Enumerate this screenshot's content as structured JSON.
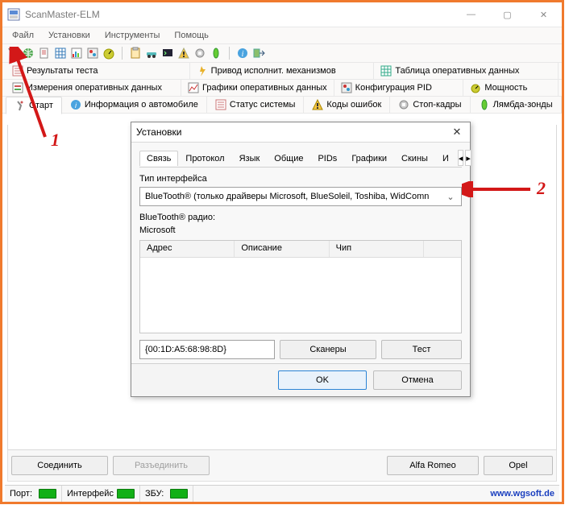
{
  "window": {
    "title": "ScanMaster-ELM",
    "controls": {
      "min": "—",
      "max": "▢",
      "close": "✕"
    }
  },
  "menu": {
    "file": "Файл",
    "settings": "Установки",
    "tools": "Инструменты",
    "help": "Помощь"
  },
  "ribbon_row1": {
    "results": "Результаты теста",
    "actuators": "Привод исполнит. механизмов",
    "runtime": "Таблица оперативных данных"
  },
  "ribbon_row2": {
    "measurements": "Измерения оперативных данных",
    "graphs": "Графики оперативных данных",
    "pidconf": "Конфигурация PID",
    "power": "Мощность"
  },
  "ribbon_row3": {
    "start": "Старт",
    "vehicle": "Информация о автомобиле",
    "status": "Статус системы",
    "codes": "Коды ошибок",
    "freeze": "Стоп-кадры",
    "lambda": "Лямбда-зонды"
  },
  "dialog": {
    "title": "Установки",
    "tabs": {
      "conn": "Связь",
      "proto": "Протокол",
      "lang": "Язык",
      "general": "Общие",
      "pids": "PIDs",
      "charts": "Графики",
      "skins": "Скины",
      "more": "И"
    },
    "iface_label": "Тип интерфейса",
    "iface_value": "BlueTooth® (только драйверы Microsoft, BlueSoleil, Toshiba, WidComn",
    "radio_label": "BlueTooth® радио:",
    "radio_value": "Microsoft",
    "grid": {
      "addr": "Адрес",
      "desc": "Описание",
      "chip": "Чип"
    },
    "mac": "{00:1D:A5:68:98:8D}",
    "btn_scanners": "Сканеры",
    "btn_test": "Тест",
    "btn_ok": "OK",
    "btn_cancel": "Отмена"
  },
  "bottom": {
    "connect": "Соединить",
    "disconnect": "Разъединить",
    "make1": "Alfa Romeo",
    "make2": "Opel"
  },
  "status": {
    "port": "Порт:",
    "iface": "Интерфейс",
    "ecu": "ЗБУ:",
    "url": "www.wgsoft.de"
  },
  "annot": {
    "one": "1",
    "two": "2"
  }
}
